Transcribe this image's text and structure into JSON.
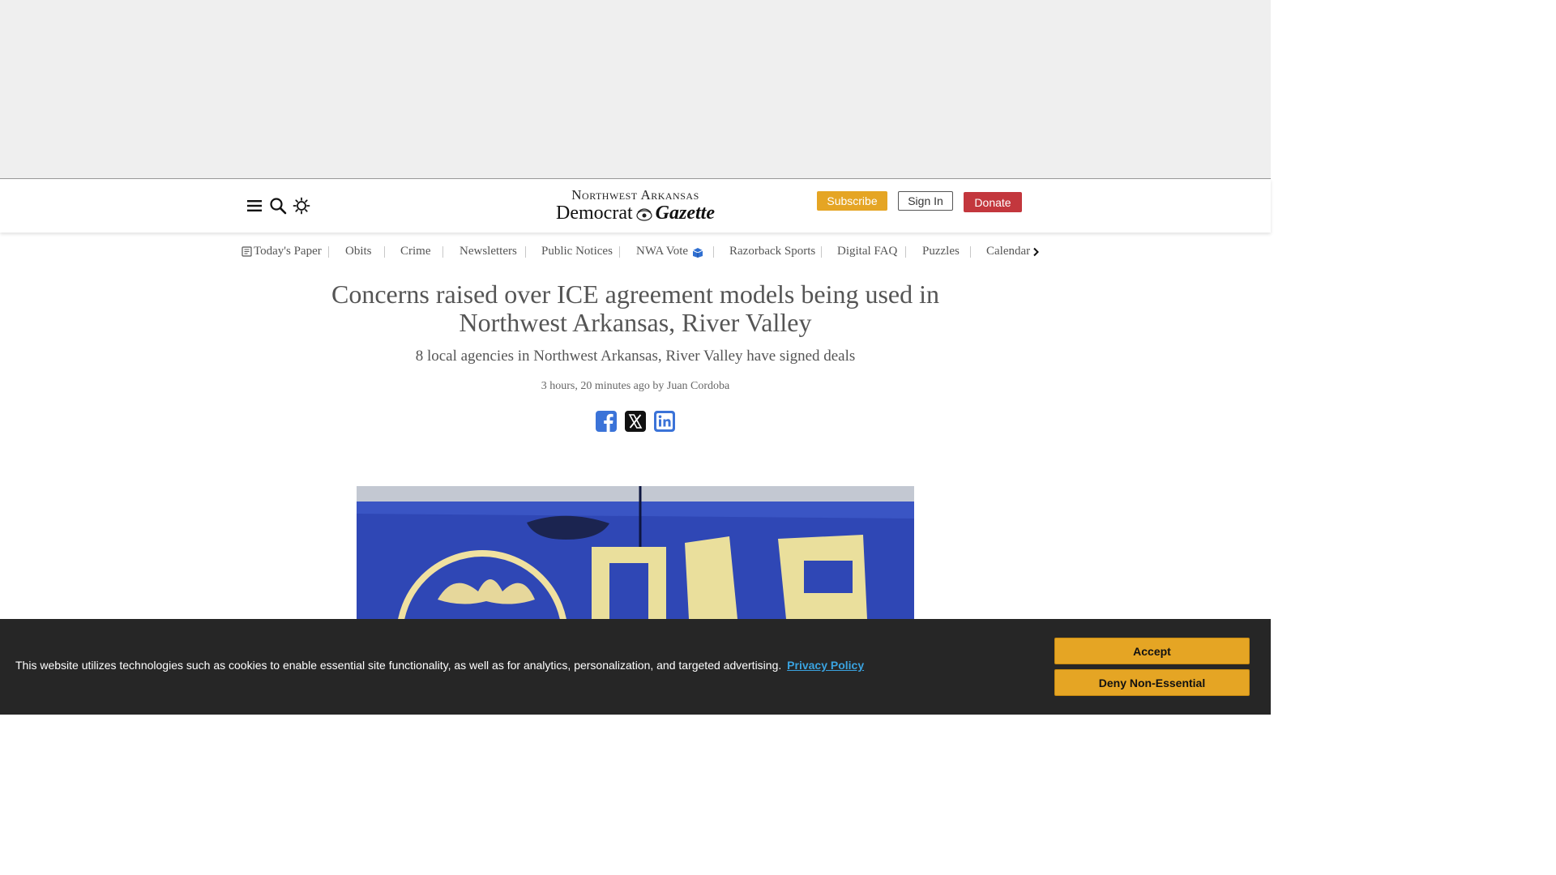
{
  "header": {
    "logo_line1": "Northwest Arkansas",
    "logo_line2a": "Democrat",
    "logo_line2b": "Gazette",
    "subscribe": "Subscribe",
    "sign_in": "Sign In",
    "donate": "Donate"
  },
  "nav": {
    "items": [
      {
        "label": "Today's Paper"
      },
      {
        "label": "Obits"
      },
      {
        "label": "Crime"
      },
      {
        "label": "Newsletters"
      },
      {
        "label": "Public Notices"
      },
      {
        "label": "NWA Vote"
      },
      {
        "label": "Razorback Sports"
      },
      {
        "label": "Digital FAQ"
      },
      {
        "label": "Puzzles"
      },
      {
        "label": "Calendar"
      }
    ]
  },
  "article": {
    "headline": "Concerns raised over ICE agreement models being used in Northwest Arkansas, River Valley",
    "subhead": "8 local agencies in Northwest Arkansas, River Valley have signed deals",
    "byline": "3 hours, 20 minutes ago by Juan Cordoba"
  },
  "cookie": {
    "text": "This website utilizes technologies such as cookies to enable essential site functionality, as well as for analytics, personalization, and targeted advertising.",
    "link": "Privacy Policy",
    "accept": "Accept",
    "deny": "Deny Non-Essential"
  },
  "icons": {
    "menu": "hamburger-icon",
    "search": "search-icon",
    "theme": "sun-icon",
    "paper": "newspaper-icon",
    "vote": "ballot-box-icon",
    "next": "chevron-right-icon",
    "share": [
      "facebook-icon",
      "x-icon",
      "linkedin-icon"
    ]
  },
  "colors": {
    "subscribe": "#e5a524",
    "donate": "#c3373d",
    "cookie_bg": "#262626",
    "link": "#3aa3e0",
    "social_blue": "#3b73d8"
  }
}
